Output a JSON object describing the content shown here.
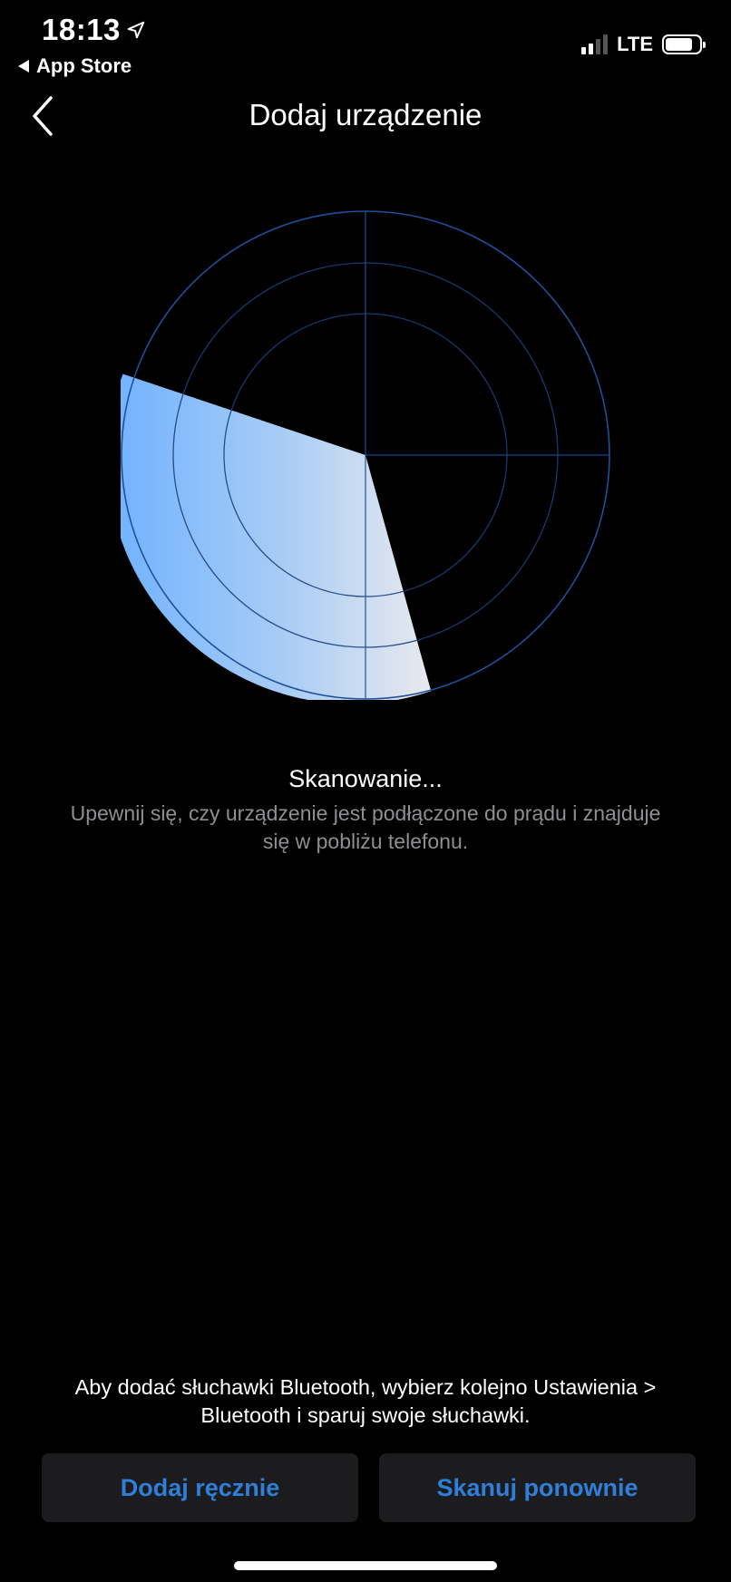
{
  "status_bar": {
    "time": "18:13",
    "back_app": "App Store",
    "network": "LTE",
    "battery_level": 0.8
  },
  "nav": {
    "title": "Dodaj urządzenie"
  },
  "scan": {
    "title": "Skanowanie...",
    "description": "Upewnij się, czy urządzenie jest podłączone do prądu i znajduje się w pobliżu telefonu."
  },
  "bluetooth_hint": "Aby dodać słuchawki Bluetooth, wybierz kolejno Ustawienia > Bluetooth i sparuj swoje słuchawki.",
  "buttons": {
    "add_manually": "Dodaj ręcznie",
    "scan_again": "Skanuj ponownie"
  },
  "colors": {
    "accent": "#2f7fd9",
    "radar_ring": "#1f4f9a",
    "sweep_light": "#6fb1ff",
    "button_bg": "#1c1c1e",
    "secondary_text": "#8e8e93"
  }
}
